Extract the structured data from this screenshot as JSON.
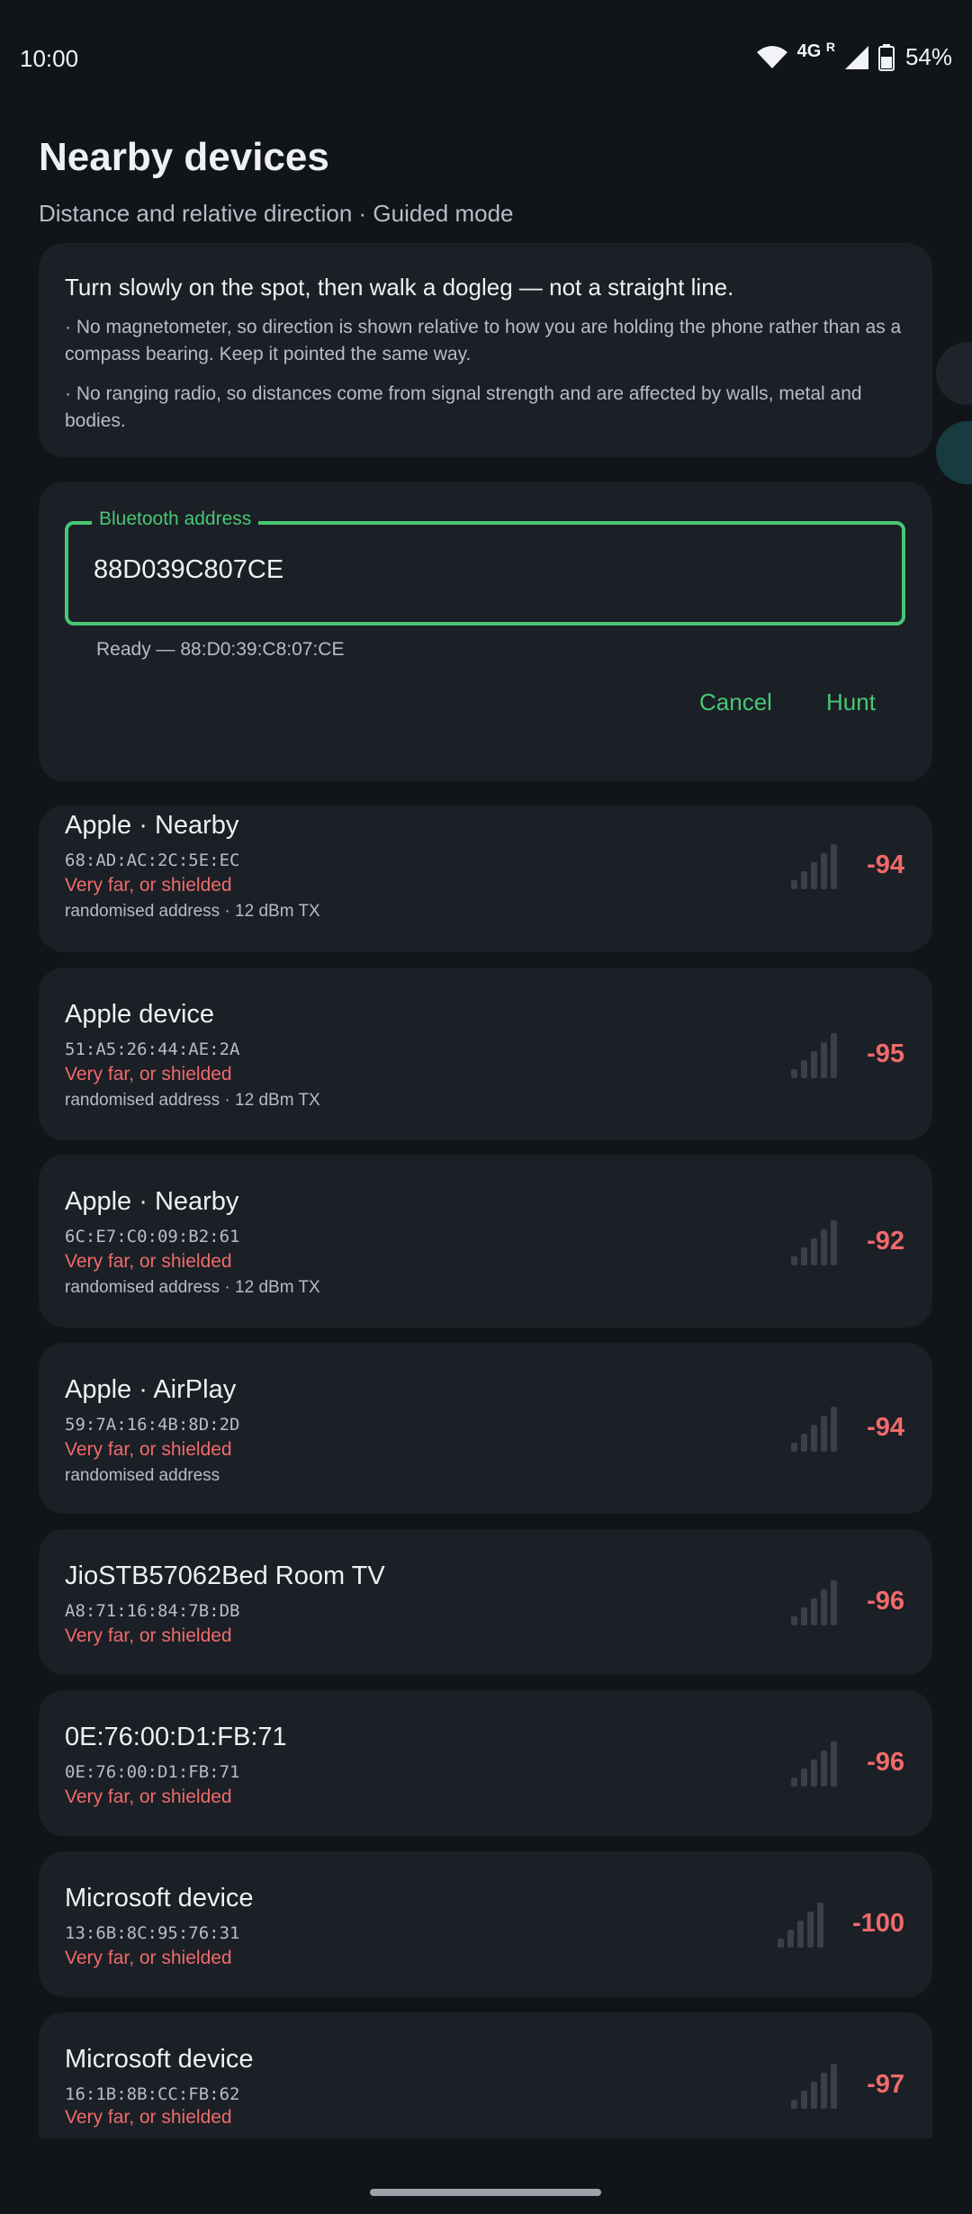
{
  "status": {
    "time": "10:00",
    "network": "4G",
    "roaming": "R",
    "battery": "54%"
  },
  "header": {
    "title": "Nearby devices",
    "subtitle": "Distance and relative direction · Guided mode"
  },
  "tip": {
    "title": "Turn slowly on the spot, then walk a dogleg — not a straight line.",
    "bullets": [
      "· No magnetometer, so direction is shown relative to how you are holding the phone rather than as a compass bearing. Keep it pointed the same way.",
      "· No ranging radio, so distances come from signal strength and are affected by walls, metal and bodies."
    ]
  },
  "dialog": {
    "label": "Bluetooth address",
    "value": "88D039C807CE",
    "helper": "Ready — 88:D0:39:C8:07:CE",
    "cancel": "Cancel",
    "hunt": "Hunt"
  },
  "devices": [
    {
      "name": "Apple · Nearby",
      "mac": "68:AD:AC:2C:5E:EC",
      "distance": "Very far, or shielded",
      "note": "randomised address · 12 dBm TX",
      "rssi": "-94"
    },
    {
      "name": "Apple device",
      "mac": "51:A5:26:44:AE:2A",
      "distance": "Very far, or shielded",
      "note": "randomised address · 12 dBm TX",
      "rssi": "-95"
    },
    {
      "name": "Apple · Nearby",
      "mac": "6C:E7:C0:09:B2:61",
      "distance": "Very far, or shielded",
      "note": "randomised address · 12 dBm TX",
      "rssi": "-92"
    },
    {
      "name": "Apple · AirPlay",
      "mac": "59:7A:16:4B:8D:2D",
      "distance": "Very far, or shielded",
      "note": "randomised address",
      "rssi": "-94"
    },
    {
      "name": "JioSTB57062Bed Room TV",
      "mac": "A8:71:16:84:7B:DB",
      "distance": "Very far, or shielded",
      "rssi": "-96"
    },
    {
      "name": "0E:76:00:D1:FB:71",
      "mac": "0E:76:00:D1:FB:71",
      "distance": "Very far, or shielded",
      "rssi": "-96"
    },
    {
      "name": "Microsoft device",
      "mac": "13:6B:8C:95:76:31",
      "distance": "Very far, or shielded",
      "rssi": "-100"
    },
    {
      "name": "Microsoft device",
      "mac": "16:1B:8B:CC:FB:62",
      "distance": "Very far, or shielded",
      "rssi": "-97"
    }
  ],
  "colors": {
    "accent": "#48c774",
    "warning": "#f06a6a",
    "background": "#111418",
    "card": "#1b1f26"
  },
  "icons": {
    "wifi": "wifi-icon",
    "signal": "cell-signal-icon",
    "battery": "battery-icon",
    "rssi_bars": "signal-bars-icon"
  }
}
